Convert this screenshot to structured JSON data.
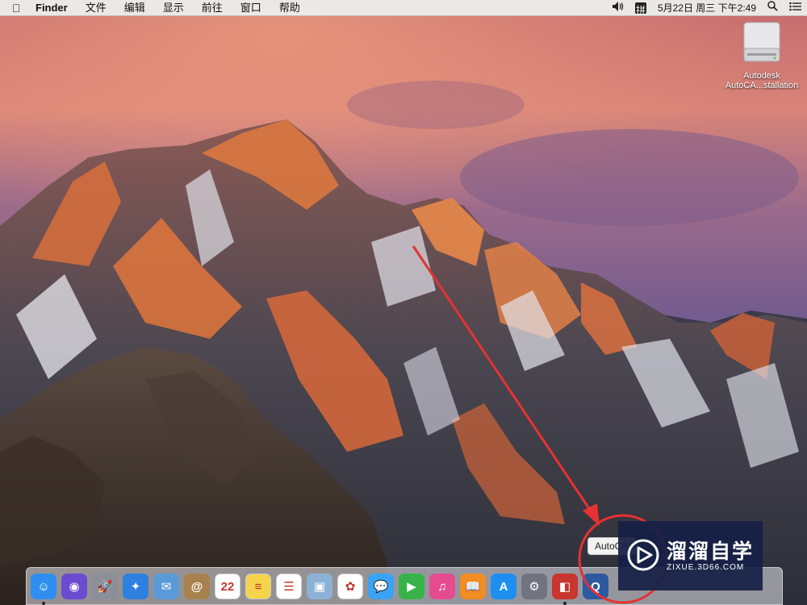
{
  "menubar": {
    "apple_icon": "apple-logo-icon",
    "app_name": "Finder",
    "items": [
      "文件",
      "编辑",
      "显示",
      "前往",
      "窗口",
      "帮助"
    ],
    "status": {
      "volume_icon": "volume-icon",
      "input_method": "拼",
      "datetime": "5月22日 周三 下午2:49",
      "search_icon": "spotlight-search-icon",
      "notification_icon": "notification-center-icon"
    }
  },
  "desktop": {
    "drive": {
      "icon": "external-drive-icon",
      "label_line1": "Autodesk",
      "label_line2": "AutoCA...stallation"
    }
  },
  "tooltip": {
    "text": "AutoCAD"
  },
  "dock": {
    "items": [
      {
        "name": "finder",
        "icon": "finder-icon",
        "glyph": "☺",
        "color": "#2f8ff0",
        "running": true
      },
      {
        "name": "siri",
        "icon": "siri-icon",
        "glyph": "◉",
        "color": "#6b4bd0",
        "running": false
      },
      {
        "name": "launchpad",
        "icon": "launchpad-icon",
        "glyph": "🚀",
        "color": "#8a8f99",
        "running": false
      },
      {
        "name": "safari",
        "icon": "safari-icon",
        "glyph": "✦",
        "color": "#2d7fe0",
        "running": false
      },
      {
        "name": "mail",
        "icon": "mail-icon",
        "glyph": "✉",
        "color": "#5a9ad8",
        "running": false
      },
      {
        "name": "contacts",
        "icon": "contacts-icon",
        "glyph": "@",
        "color": "#a8824e",
        "running": false
      },
      {
        "name": "calendar",
        "icon": "calendar-icon",
        "glyph": "22",
        "color": "#ffffff",
        "running": false
      },
      {
        "name": "notes",
        "icon": "notes-icon",
        "glyph": "≡",
        "color": "#f5d34a",
        "running": false
      },
      {
        "name": "reminders",
        "icon": "reminders-icon",
        "glyph": "☰",
        "color": "#ffffff",
        "running": false
      },
      {
        "name": "preview",
        "icon": "preview-icon",
        "glyph": "▣",
        "color": "#8bb2d6",
        "running": false
      },
      {
        "name": "photos",
        "icon": "photos-icon",
        "glyph": "✿",
        "color": "#ffffff",
        "running": false
      },
      {
        "name": "messages",
        "icon": "messages-icon",
        "glyph": "💬",
        "color": "#3aa3f5",
        "running": false
      },
      {
        "name": "facetime",
        "icon": "facetime-icon",
        "glyph": "▶",
        "color": "#37b34a",
        "running": false
      },
      {
        "name": "itunes",
        "icon": "itunes-icon",
        "glyph": "♫",
        "color": "#e54b8f",
        "running": false
      },
      {
        "name": "ibooks",
        "icon": "ibooks-icon",
        "glyph": "📖",
        "color": "#f18d22",
        "running": false
      },
      {
        "name": "app-store",
        "icon": "app-store-icon",
        "glyph": "A",
        "color": "#1e8ff0",
        "running": false
      },
      {
        "name": "system-preferences",
        "icon": "system-preferences-icon",
        "glyph": "⚙",
        "color": "#6f7480",
        "running": false
      },
      {
        "name": "autocad-installer",
        "icon": "autocad-installer-icon",
        "glyph": "◧",
        "color": "#c8362d",
        "running": true
      },
      {
        "name": "quicktime",
        "icon": "quicktime-icon",
        "glyph": "Q",
        "color": "#2c5aa0",
        "running": false
      }
    ]
  },
  "watermark": {
    "logo_icon": "zixue-play-logo-icon",
    "title": "溜溜自学",
    "subtitle": "ZIXUE.3D66.COM"
  },
  "colors": {
    "annotation_red": "#e63232",
    "watermark_bg": "#162046"
  }
}
